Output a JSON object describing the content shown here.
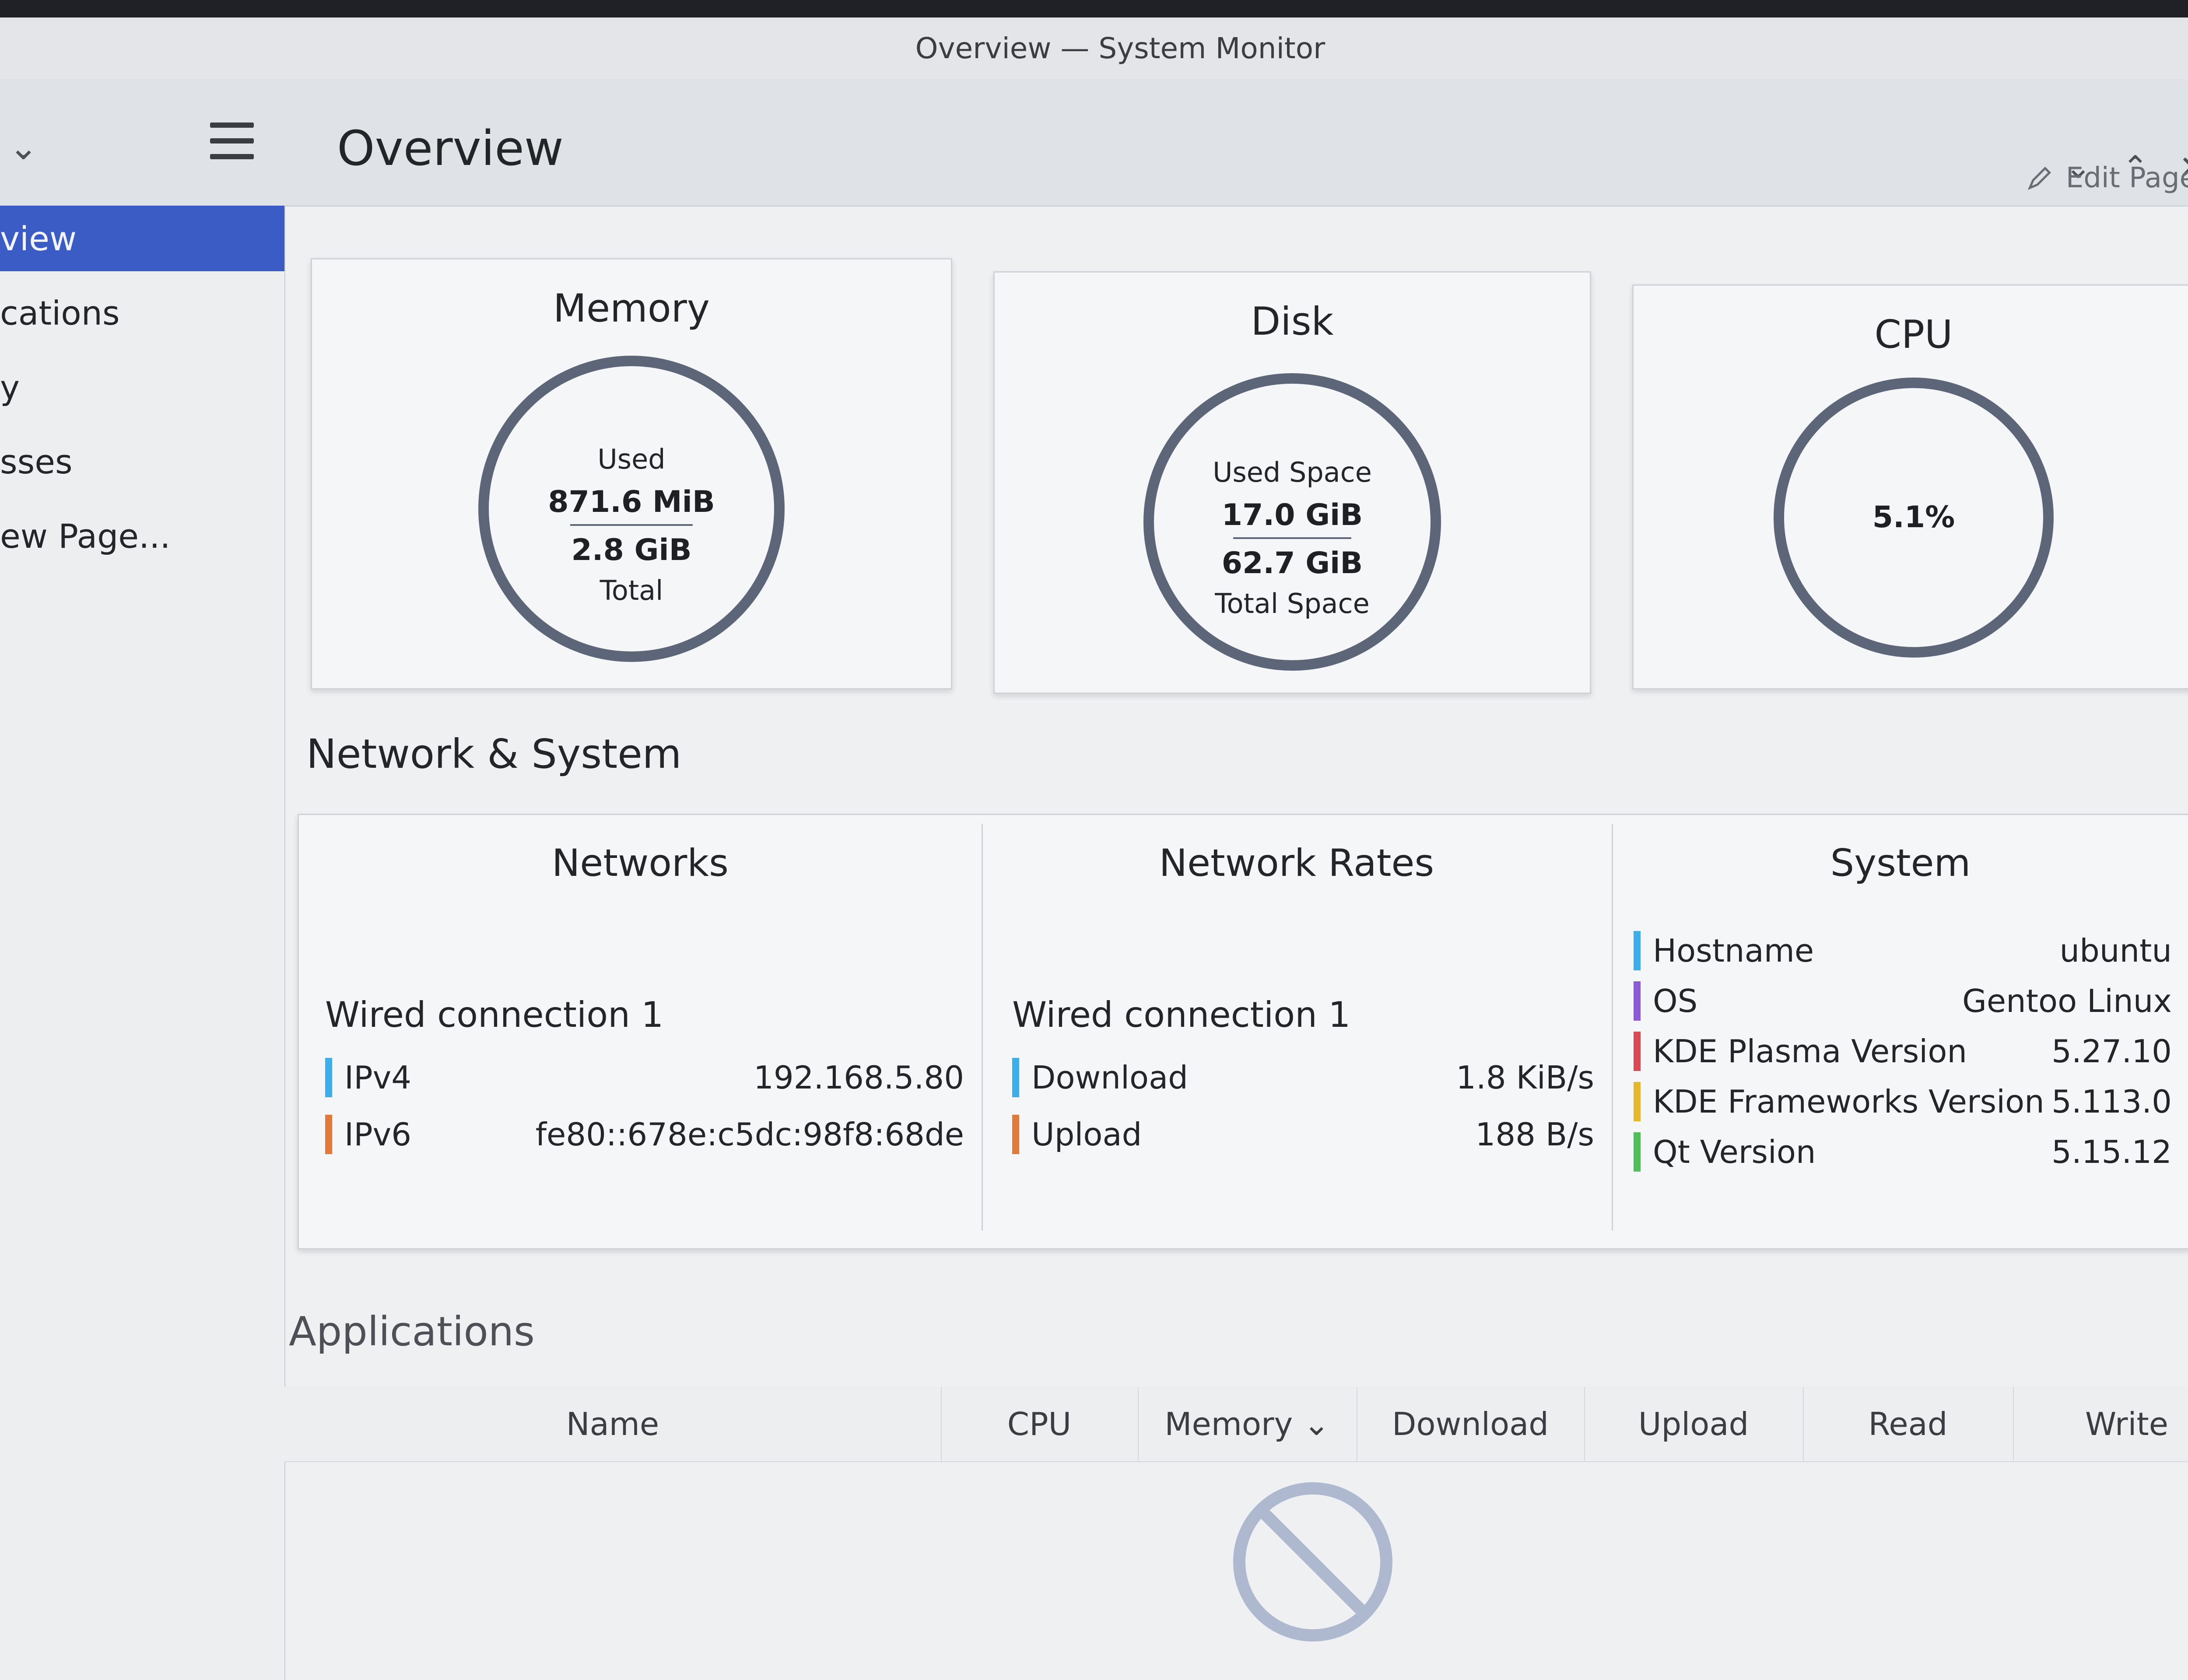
{
  "window": {
    "title": "Overview — System Monitor",
    "controls": {
      "minimize": "⌄",
      "maximize": "⌃",
      "close": "✕"
    }
  },
  "toolbar": {
    "sidebar_toggle": "⌄",
    "page_heading": "Overview",
    "edit_page": "Edit Page"
  },
  "sidebar": {
    "items": [
      {
        "label": "view",
        "active": true
      },
      {
        "label": "cations",
        "active": false
      },
      {
        "label": "y",
        "active": false
      },
      {
        "label": "sses",
        "active": false
      },
      {
        "label": "ew Page...",
        "active": false
      }
    ]
  },
  "cards": {
    "memory": {
      "title": "Memory",
      "top_label": "Used",
      "top_value": "871.6 MiB",
      "bottom_value": "2.8 GiB",
      "bottom_label": "Total"
    },
    "disk": {
      "title": "Disk",
      "top_label": "Used Space",
      "top_value": "17.0 GiB",
      "bottom_value": "62.7 GiB",
      "bottom_label": "Total Space"
    },
    "cpu": {
      "title": "CPU",
      "value": "5.1%"
    }
  },
  "network_system": {
    "section_title": "Network & System",
    "networks": {
      "title": "Networks",
      "connection": "Wired connection 1",
      "rows": [
        {
          "label": "IPv4",
          "value": "192.168.5.80",
          "color": "#3daee9"
        },
        {
          "label": "IPv6",
          "value": "fe80::678e:c5dc:98f8:68de",
          "color": "#e0793a"
        }
      ]
    },
    "rates": {
      "title": "Network Rates",
      "connection": "Wired connection 1",
      "rows": [
        {
          "label": "Download",
          "value": "1.8 KiB/s",
          "color": "#3daee9"
        },
        {
          "label": "Upload",
          "value": "188 B/s",
          "color": "#e0793a"
        }
      ]
    },
    "system": {
      "title": "System",
      "rows": [
        {
          "label": "Hostname",
          "value": "ubuntu",
          "color": "#3daee9"
        },
        {
          "label": "OS",
          "value": "Gentoo Linux",
          "color": "#8e5bd6"
        },
        {
          "label": "KDE Plasma Version",
          "value": "5.27.10",
          "color": "#d94a57"
        },
        {
          "label": "KDE Frameworks Version",
          "value": "5.113.0",
          "color": "#e5b72b"
        },
        {
          "label": "Qt Version",
          "value": "5.15.12",
          "color": "#4fbf58"
        }
      ]
    }
  },
  "applications": {
    "section_title": "Applications",
    "columns": [
      "Name",
      "CPU",
      "Memory",
      "Download",
      "Upload",
      "Read",
      "Write"
    ],
    "sort_indicator": "⌄"
  }
}
